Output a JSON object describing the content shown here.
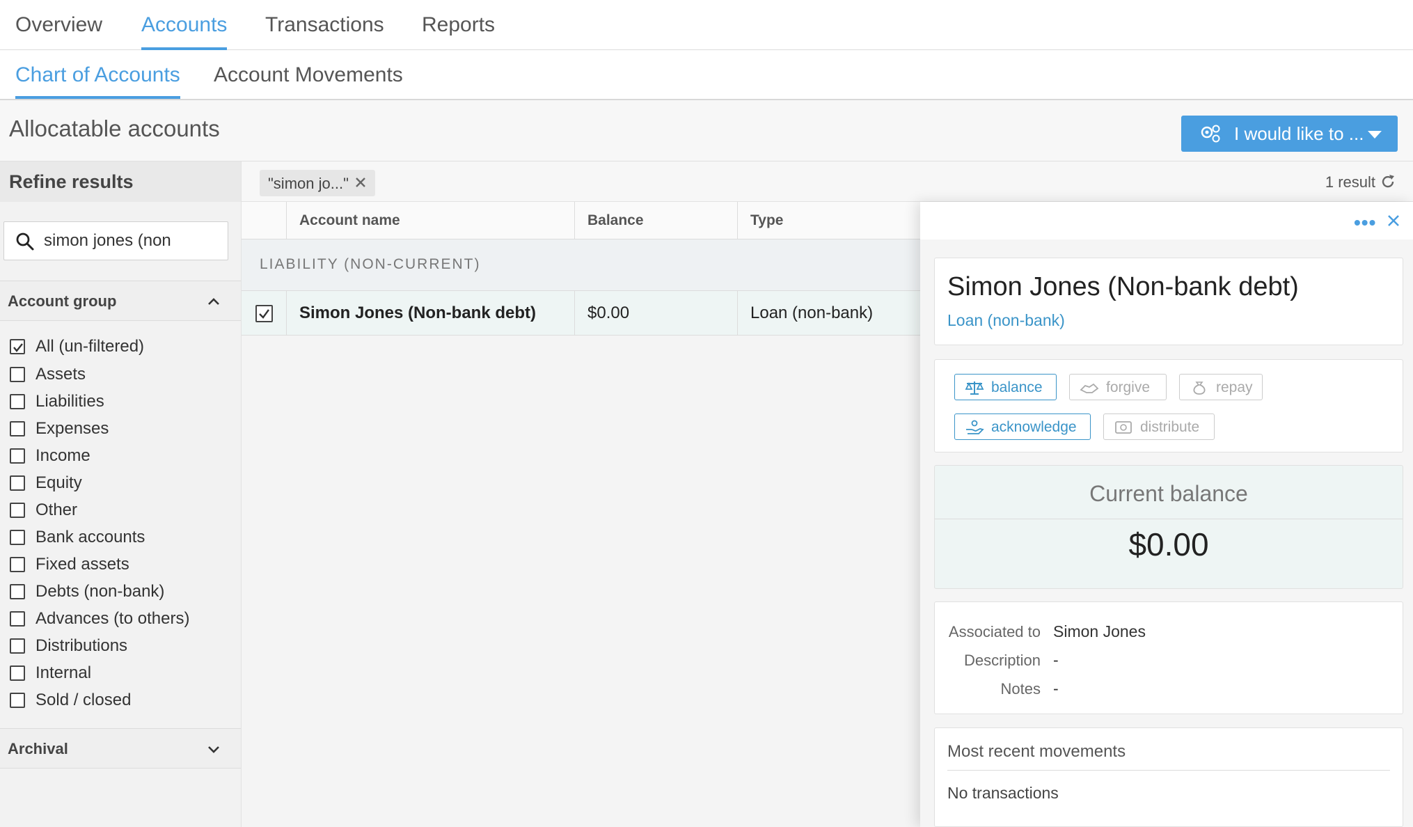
{
  "top_tabs": [
    "Overview",
    "Accounts",
    "Transactions",
    "Reports"
  ],
  "sub_tabs": [
    "Chart of Accounts",
    "Account Movements"
  ],
  "page_title": "Allocatable accounts",
  "action_button": "I would like to ...",
  "sidebar": {
    "refine_title": "Refine results",
    "search_value": "simon jones (non",
    "account_group_title": "Account group",
    "account_groups": [
      {
        "label": "All (un-filtered)",
        "checked": true
      },
      {
        "label": "Assets",
        "checked": false
      },
      {
        "label": "Liabilities",
        "checked": false
      },
      {
        "label": "Expenses",
        "checked": false
      },
      {
        "label": "Income",
        "checked": false
      },
      {
        "label": "Equity",
        "checked": false
      },
      {
        "label": "Other",
        "checked": false
      },
      {
        "label": "Bank accounts",
        "checked": false
      },
      {
        "label": "Fixed assets",
        "checked": false
      },
      {
        "label": "Debts (non-bank)",
        "checked": false
      },
      {
        "label": "Advances (to others)",
        "checked": false
      },
      {
        "label": "Distributions",
        "checked": false
      },
      {
        "label": "Internal",
        "checked": false
      },
      {
        "label": "Sold / closed",
        "checked": false
      }
    ],
    "archival_title": "Archival"
  },
  "filter_chip": "\"simon jo...\"",
  "result_count": "1 result",
  "table": {
    "columns": [
      "Account name",
      "Balance",
      "Type"
    ],
    "group_label": "LIABILITY (NON-CURRENT)",
    "rows": [
      {
        "name": "Simon Jones (Non-bank debt)",
        "balance": "$0.00",
        "type": "Loan (non-bank)",
        "checked": true
      }
    ]
  },
  "panel": {
    "title": "Simon Jones (Non-bank debt)",
    "type": "Loan (non-bank)",
    "actions": [
      {
        "label": "balance",
        "enabled": true,
        "icon": "scale-icon"
      },
      {
        "label": "forgive",
        "enabled": false,
        "icon": "handshake-icon"
      },
      {
        "label": "repay",
        "enabled": false,
        "icon": "money-bag-icon"
      },
      {
        "label": "acknowledge",
        "enabled": true,
        "icon": "hand-coin-icon"
      },
      {
        "label": "distribute",
        "enabled": false,
        "icon": "cash-icon"
      }
    ],
    "balance_label": "Current balance",
    "balance_value": "$0.00",
    "details": [
      {
        "key": "Associated to",
        "value": "Simon Jones"
      },
      {
        "key": "Description",
        "value": "-"
      },
      {
        "key": "Notes",
        "value": "-"
      }
    ],
    "movements_title": "Most recent movements",
    "movements_empty": "No transactions"
  },
  "colors": {
    "accent": "#4a9ee0",
    "link": "#3a94c8",
    "selected_row": "#eef5f4"
  }
}
